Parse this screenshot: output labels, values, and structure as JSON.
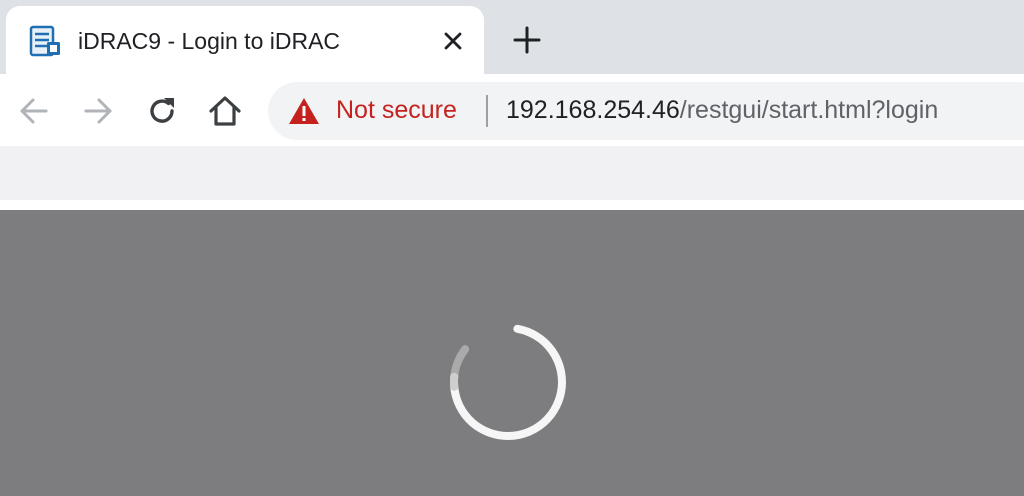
{
  "tab": {
    "title": "iDRAC9 - Login to iDRAC",
    "favicon": "server-icon",
    "close_icon": "close-icon"
  },
  "new_tab_icon": "plus-icon",
  "toolbar": {
    "back_icon": "arrow-left-icon",
    "forward_icon": "arrow-right-icon",
    "reload_icon": "reload-icon",
    "home_icon": "home-icon"
  },
  "omnibox": {
    "security_icon": "warning-triangle-icon",
    "security_label": "Not secure",
    "url_host": "192.168.254.46",
    "url_path": "/restgui/start.html?login"
  },
  "content": {
    "state": "loading",
    "spinner_icon": "loading-spinner-icon"
  },
  "colors": {
    "tabstrip_bg": "#dee1e6",
    "not_secure_red": "#c5221f",
    "content_bg": "#7d7c7f",
    "spinner": "#ffffff"
  }
}
